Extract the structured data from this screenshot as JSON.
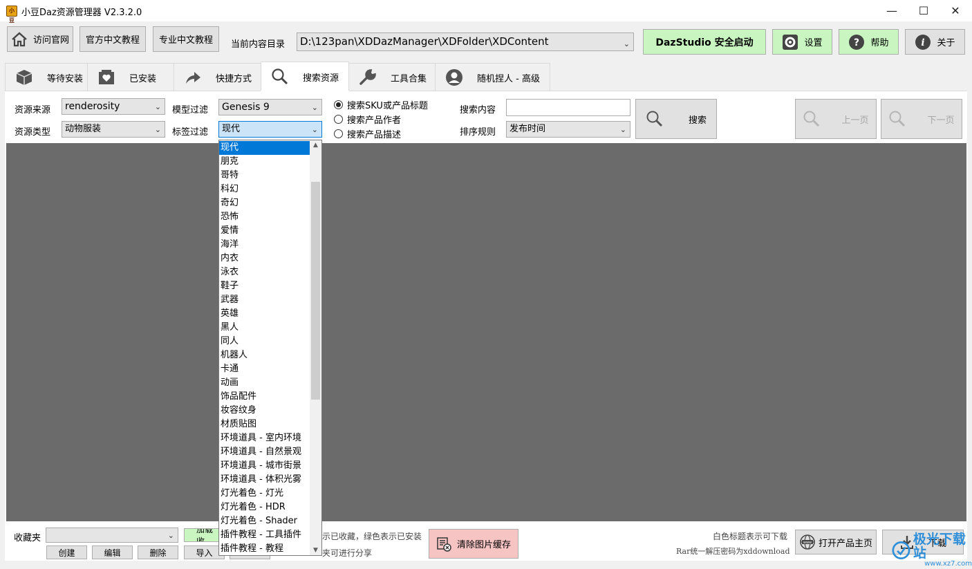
{
  "window": {
    "title": "小豆Daz资源管理器 V2.3.2.0",
    "icon_text": "小豆",
    "minimize": "—",
    "maximize": "☐",
    "close": "✕"
  },
  "toolbar": {
    "visit_site": "访问官网",
    "official_tutorial": "官方中文教程",
    "pro_tutorial": "专业中文教程",
    "content_dir_label": "当前内容目录",
    "content_dir_value": "D:\\123pan\\XDDazManager\\XDFolder\\XDContent",
    "daz_start": "DazStudio 安全启动",
    "settings": "设置",
    "help": "帮助",
    "about": "关于"
  },
  "tabs": [
    {
      "label": "等待安装",
      "icon": "package-icon"
    },
    {
      "label": "已安装",
      "icon": "heart-box-icon"
    },
    {
      "label": "快捷方式",
      "icon": "arrow-icon"
    },
    {
      "label": "搜索资源",
      "icon": "search-icon"
    },
    {
      "label": "工具合集",
      "icon": "wrench-icon"
    },
    {
      "label": "随机捏人 - 高级",
      "icon": "user-icon"
    }
  ],
  "filters": {
    "source_label": "资源来源",
    "source_value": "renderosity",
    "type_label": "资源类型",
    "type_value": "动物服装",
    "model_label": "模型过滤",
    "model_value": "Genesis 9",
    "tag_label": "标签过滤",
    "tag_value": "现代",
    "radio_sku": "搜索SKU或产品标题",
    "radio_author": "搜索产品作者",
    "radio_desc": "搜索产品描述",
    "search_content_label": "搜索内容",
    "search_content_value": "",
    "sort_label": "排序规则",
    "sort_value": "发布时间",
    "search_button": "搜索",
    "prev_page": "上一页",
    "next_page": "下一页"
  },
  "tag_options": [
    "现代",
    "朋克",
    "哥特",
    "科幻",
    "奇幻",
    "恐怖",
    "爱情",
    "海洋",
    "内衣",
    "泳衣",
    "鞋子",
    "武器",
    "英雄",
    "黑人",
    "同人",
    "机器人",
    "卡通",
    "动画",
    "饰品配件",
    "妆容纹身",
    "材质贴图",
    "环境道具 - 室内环境",
    "环境道具 - 自然景观",
    "环境道具 - 城市街景",
    "环境道具 - 体积光雾",
    "灯光着色 - 灯光",
    "灯光着色 - HDR",
    "灯光着色 - Shader",
    "插件教程 - 工具插件",
    "插件教程 - 教程"
  ],
  "bottom": {
    "favorites_label": "收藏夹",
    "load_button": "加载收",
    "create": "创建",
    "edit": "编辑",
    "delete": "删除",
    "import": "导入",
    "hint1_partial": "示已收藏，绿色表示已安装",
    "hint2_partial": "夹可进行分享",
    "clear_cache": "清除图片缓存",
    "white_title_hint": "白色标题表示可下载",
    "rar_hint": "Rar统一解压密码为xddownload",
    "open_product_page": "打开产品主页",
    "download": "下载"
  },
  "watermark": {
    "text": "极光下载站",
    "url": "www.xz7.com"
  },
  "colors": {
    "green_button": "#c8f5c0",
    "red_button": "#f7c4c4",
    "selection": "#0078d7",
    "content_bg": "#6b6b6b"
  }
}
